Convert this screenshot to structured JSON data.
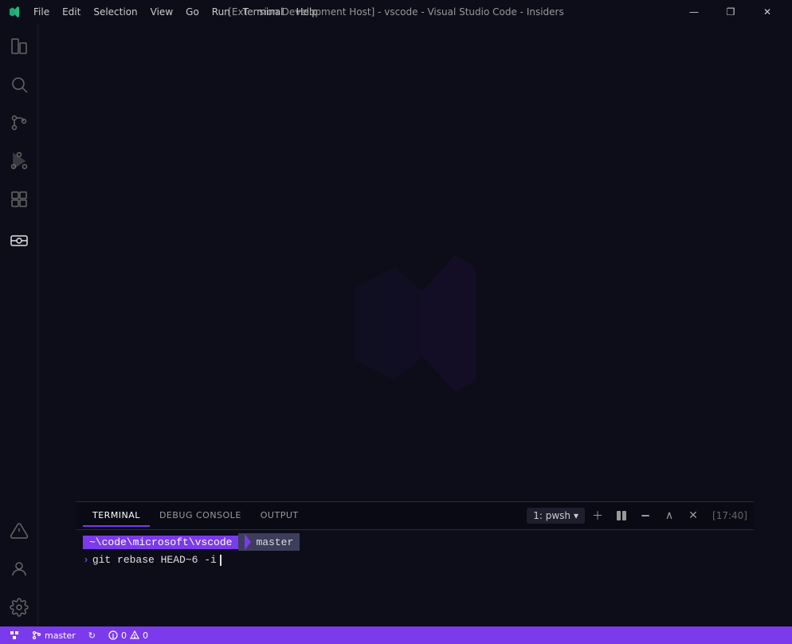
{
  "titleBar": {
    "title": "[Extension Development Host] - vscode - Visual Studio Code - Insiders",
    "menuItems": [
      "File",
      "Edit",
      "Selection",
      "View",
      "Go",
      "Run",
      "Terminal",
      "Help"
    ],
    "windowControls": {
      "minimize": "—",
      "restore": "❐",
      "close": "✕"
    }
  },
  "panel": {
    "tabs": [
      "TERMINAL",
      "DEBUG CONSOLE",
      "OUTPUT"
    ],
    "activeTab": "TERMINAL",
    "terminalName": "1: pwsh",
    "timestamp": "[17:40]",
    "promptPath": "~\\code\\microsoft\\vscode",
    "promptBranch": "master",
    "command": "git rebase HEAD~6 -i"
  },
  "statusBar": {
    "branch": "master",
    "syncIcon": "↻",
    "errors": "0",
    "warnings": "0",
    "liveShare": ""
  },
  "activityBar": {
    "items": [
      {
        "name": "explorer-icon",
        "title": "Explorer"
      },
      {
        "name": "search-icon",
        "title": "Search"
      },
      {
        "name": "source-control-icon",
        "title": "Source Control"
      },
      {
        "name": "run-debug-icon",
        "title": "Run and Debug"
      },
      {
        "name": "extensions-icon",
        "title": "Extensions"
      },
      {
        "name": "remote-explorer-icon",
        "title": "Remote Explorer"
      },
      {
        "name": "account-icon",
        "title": "Account"
      },
      {
        "name": "settings-icon",
        "title": "Settings"
      }
    ]
  }
}
